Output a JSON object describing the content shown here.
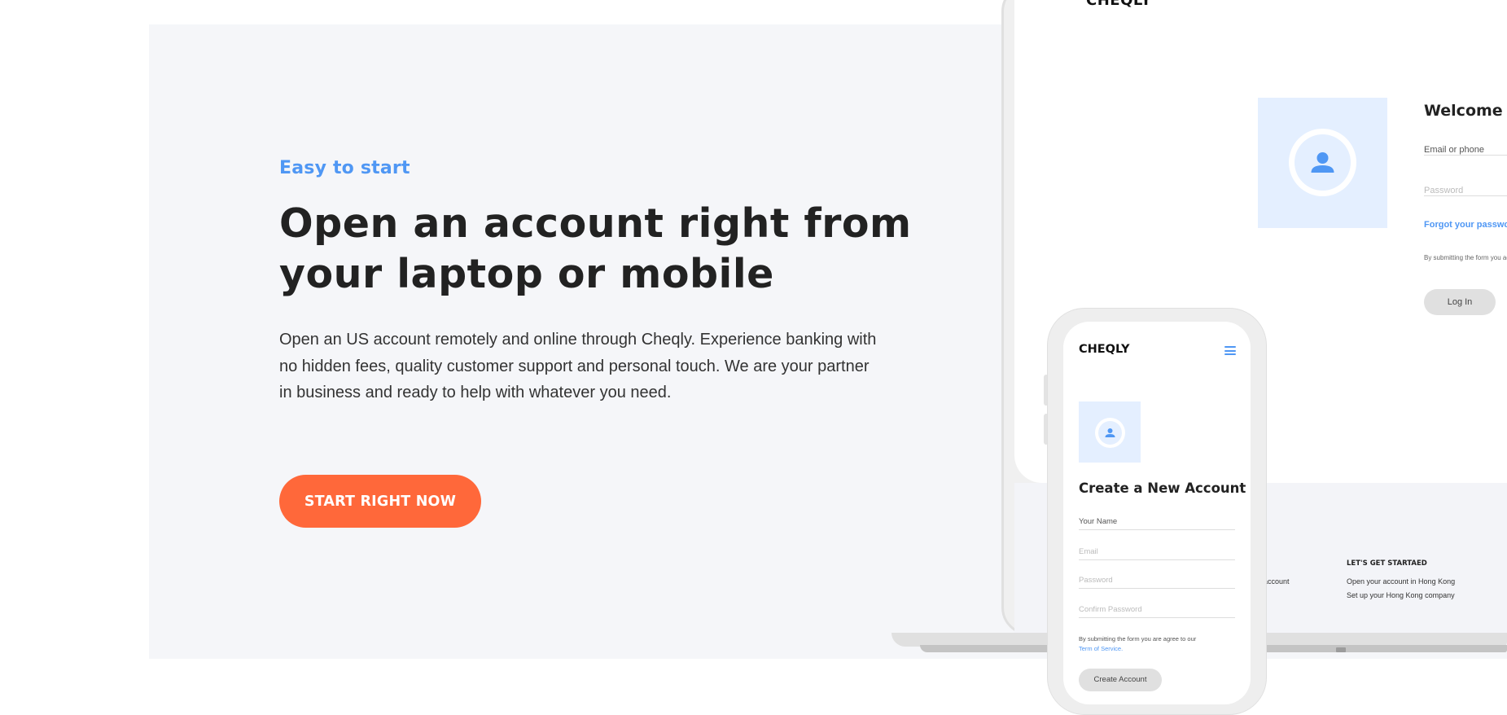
{
  "hero": {
    "eyebrow": "Easy to start",
    "headline": "Open an account right from your laptop or mobile",
    "description": "Open an US account remotely and online through Cheqly. Experience banking with no hidden fees, quality customer support and personal touch. We are your partner in business and ready to help with whatever you need.",
    "cta_label": "START RIGHT NOW"
  },
  "colors": {
    "accent_blue": "#4f97f4",
    "cta_orange": "#ff683a",
    "section_background": "#f5f6f9",
    "heading_text": "#222222"
  },
  "laptop_mockup": {
    "logo": "CHEQLY",
    "welcome_title": "Welcome back",
    "email_placeholder": "Email or phone",
    "password_placeholder": "Password",
    "forgot_password": "Forgot your password?",
    "terms_text": "By submitting the form you agree to our Term of Service.",
    "login_button": "Log In",
    "avatar_icon": "user-icon",
    "footer": {
      "partial_link": "account",
      "heading": "LET'S GET STARTAED",
      "links": [
        "Open your account in Hong Kong",
        "Set up your Hong Kong company"
      ]
    }
  },
  "phone_mockup": {
    "logo": "CHEQLY",
    "menu_icon": "hamburger-menu-icon",
    "avatar_icon": "user-icon",
    "title": "Create a New Account",
    "fields": {
      "name_placeholder": "Your Name",
      "email_placeholder": "Email",
      "password_placeholder": "Password",
      "confirm_placeholder": "Confirm Password"
    },
    "terms_prefix": "By submitting the form you are agree to our",
    "terms_link": "Term of Service.",
    "create_button": "Create Account"
  }
}
